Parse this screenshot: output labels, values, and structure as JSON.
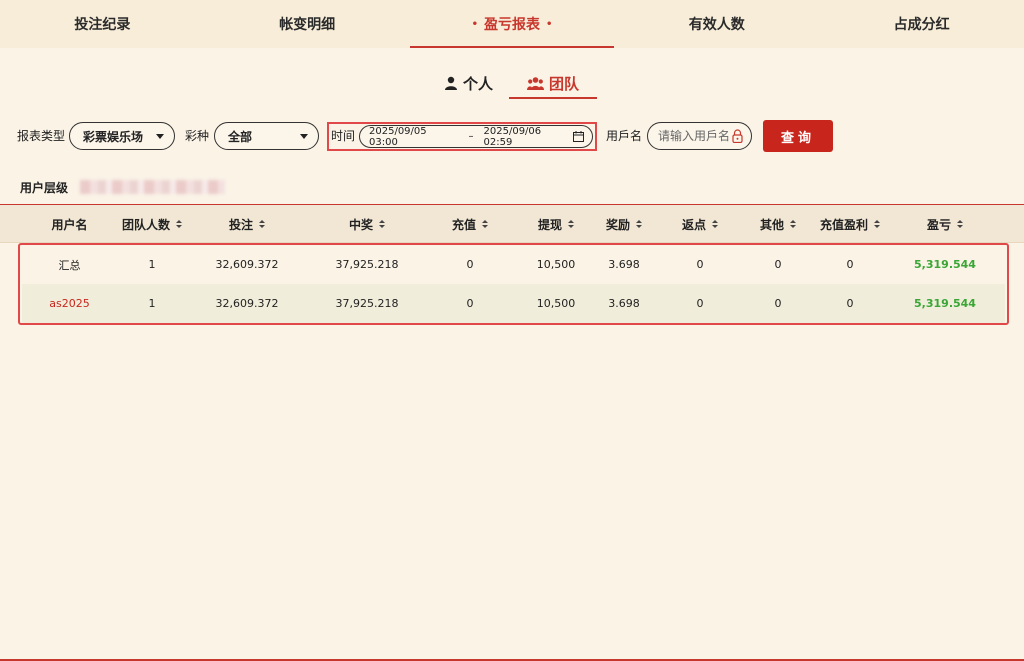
{
  "tabs": [
    {
      "label": "投注纪录"
    },
    {
      "label": "帐变明细"
    },
    {
      "label": "盈亏报表",
      "active": true
    },
    {
      "label": "有效人数"
    },
    {
      "label": "占成分红"
    }
  ],
  "switch": {
    "person": "个人",
    "team": "团队",
    "active": "team"
  },
  "filters": {
    "report_type_label": "报表类型",
    "report_type_value": "彩票娱乐场",
    "lottery_label": "彩种",
    "lottery_value": "全部",
    "time_label": "时间",
    "time_start": "2025/09/05 03:00",
    "time_sep": "–",
    "time_end": "2025/09/06 02:59",
    "username_label": "用戶名",
    "username_placeholder": "请输入用戶名",
    "query_button": "查询"
  },
  "user_level": {
    "label": "用户层级"
  },
  "table": {
    "columns": [
      "用户名",
      "团队人数",
      "投注",
      "中奖",
      "充值",
      "提现",
      "奖励",
      "返点",
      "其他",
      "充值盈利",
      "盈亏"
    ],
    "rows": [
      [
        "汇总",
        "1",
        "32,609.372",
        "37,925.218",
        "0",
        "10,500",
        "3.698",
        "0",
        "0",
        "0",
        "5,319.544"
      ],
      [
        "as2025",
        "1",
        "32,609.372",
        "37,925.218",
        "0",
        "10,500",
        "3.698",
        "0",
        "0",
        "0",
        "5,319.544"
      ]
    ]
  },
  "colors": {
    "accent": "#c8372d",
    "profit": "#3aa635",
    "background": "#faf3e6"
  }
}
